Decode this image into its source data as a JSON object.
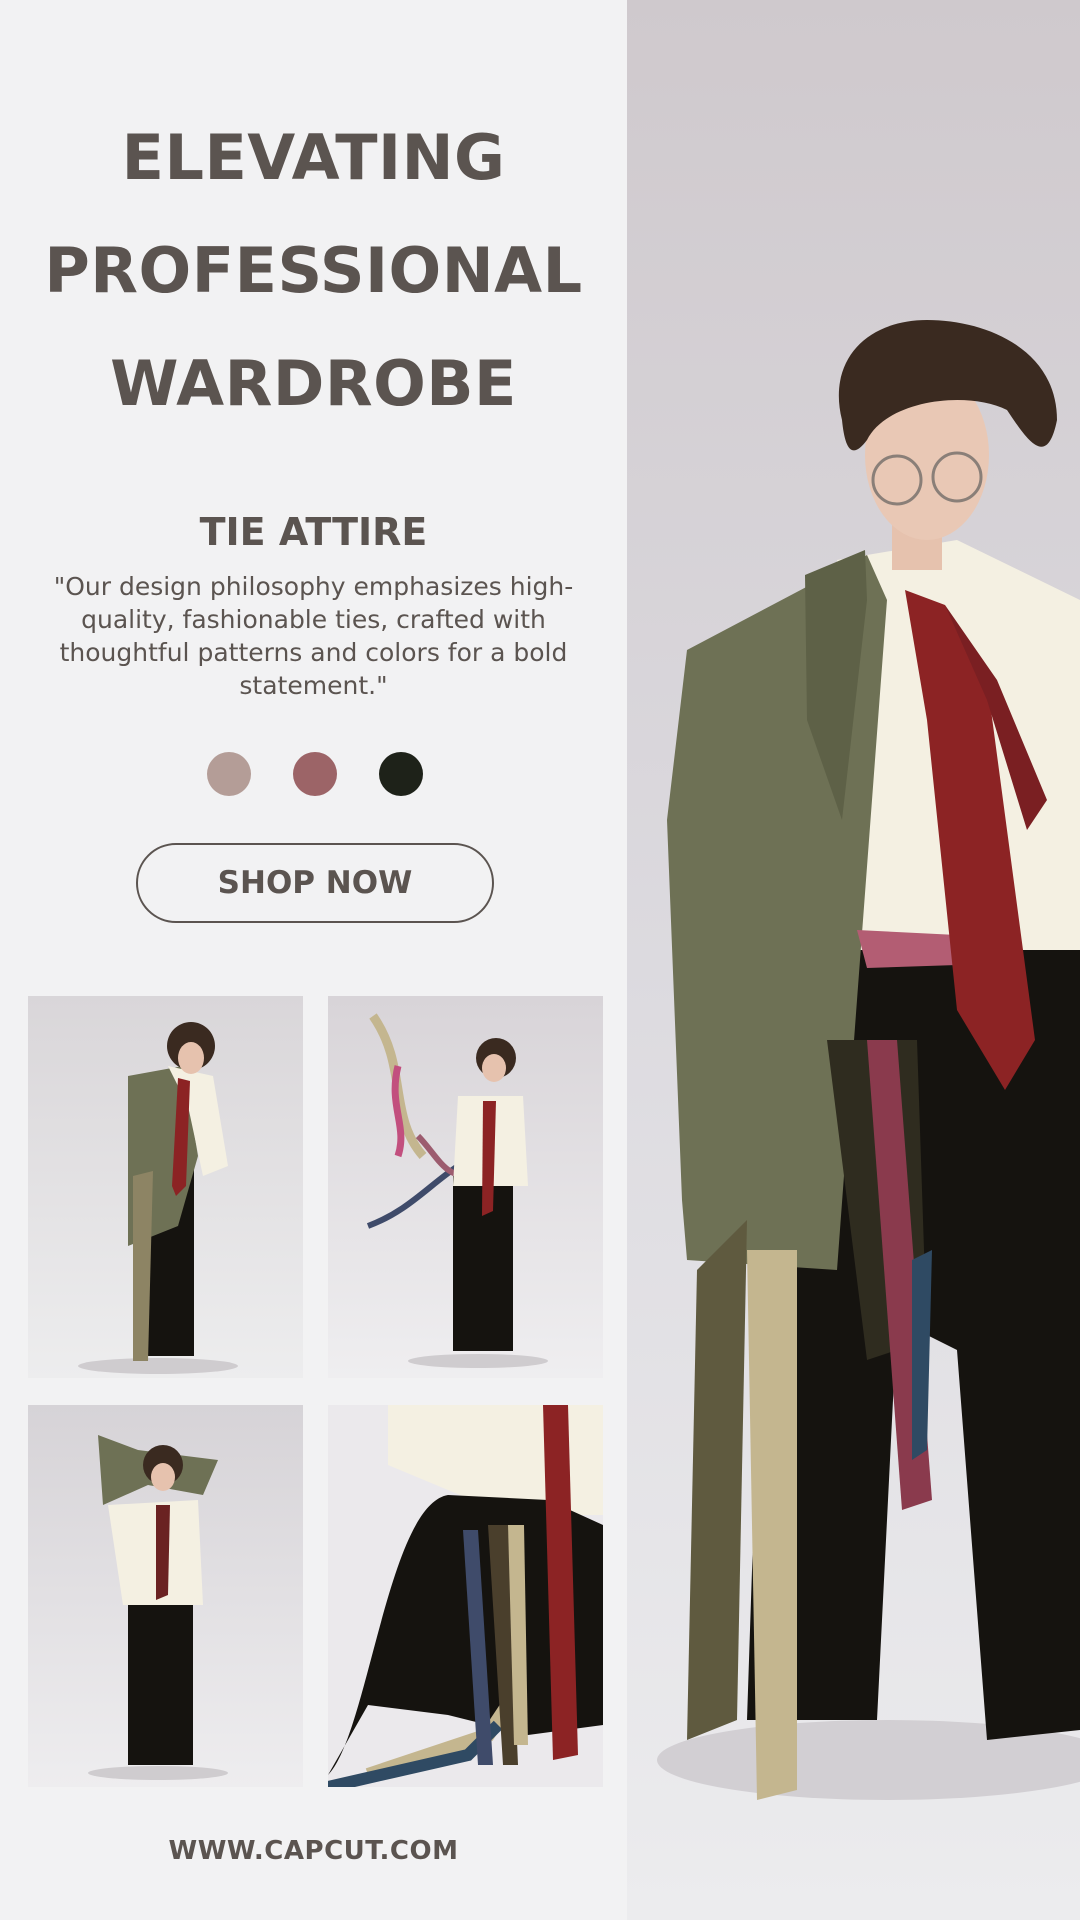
{
  "headline": {
    "line1": "ELEVATING",
    "line2": "PROFESSIONAL",
    "line3": "WARDROBE"
  },
  "subtitle": "TIE ATTIRE",
  "quote": "\"Our design philosophy emphasizes high-quality, fashionable ties, crafted with thoughtful patterns and colors for a bold statement.\"",
  "swatches": [
    "#b49d97",
    "#9c6467",
    "#1e2219"
  ],
  "cta": {
    "label": "SHOP NOW"
  },
  "gallery": [
    {
      "name": "model-standing-hand-in-pocket-photo"
    },
    {
      "name": "model-throwing-ties-photo"
    },
    {
      "name": "model-jacket-over-head-photo"
    },
    {
      "name": "ties-closeup-photo"
    }
  ],
  "hero": {
    "name": "model-portrait-photo"
  },
  "footer": {
    "website": "WWW.CAPCUT.COM"
  },
  "colors": {
    "background": "#f2f2f3",
    "text": "#5b5450",
    "jacket": "#6e7155",
    "tie": "#8c2324",
    "shirt": "#f4f0e2",
    "trousers": "#15130f"
  }
}
